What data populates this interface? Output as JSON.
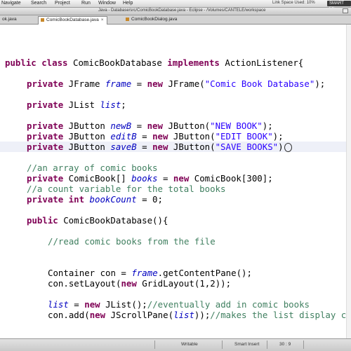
{
  "menubar": {
    "items": [
      "Navigate",
      "Search",
      "Project",
      "Run",
      "Window",
      "Help"
    ],
    "status": "Link Space Used: 10%",
    "badge": "SMART FIL"
  },
  "window": {
    "title": "Java - Database/src/ComicBookDatabase.java - Eclipse - /Volumes/CANTELE/workspace"
  },
  "tabs": [
    {
      "label": "ok.java",
      "active": false
    },
    {
      "label": "ComicBookDatabase.java",
      "active": true
    },
    {
      "label": "ComicBookDialog.java",
      "active": false
    }
  ],
  "code": {
    "class_decl": {
      "kw": "public class",
      "name": " ComicBookDatabase ",
      "kw2": "implements",
      "rest": " ActionListener{"
    },
    "frame_line": {
      "kw": "private",
      "type": " JFrame ",
      "field": "frame",
      "mid": " = ",
      "kw2": "new",
      "ctor": " JFrame(",
      "str": "\"Comic Book Database\"",
      "end": ");"
    },
    "list_line": {
      "kw": "private",
      "type": " JList ",
      "field": "list",
      "end": ";"
    },
    "newb_line": {
      "kw": "private",
      "type": " JButton ",
      "field": "newB",
      "mid": " = ",
      "kw2": "new",
      "ctor": " JButton(",
      "str": "\"NEW BOOK\"",
      "end": ");"
    },
    "editb_line": {
      "kw": "private",
      "type": " JButton ",
      "field": "editB",
      "mid": " = ",
      "kw2": "new",
      "ctor": " JButton(",
      "str": "\"EDIT BOOK\"",
      "end": ");"
    },
    "saveb_line": {
      "kw": "private",
      "type": " JButton ",
      "field": "saveB",
      "mid": " = ",
      "kw2": "new",
      "ctor": " JButton(",
      "str": "\"SAVE BOOKS\"",
      "end": ")"
    },
    "comment1": "//an array of comic books",
    "books_line": {
      "kw": "private",
      "type": " ComicBook[] ",
      "field": "books",
      "mid": " = ",
      "kw2": "new",
      "rest": " ComicBook[300];"
    },
    "comment2": "//a count variable for the total books",
    "count_line": {
      "kw": "private int",
      "field": " bookCount",
      "rest": " = 0;"
    },
    "ctor_line": {
      "kw": "public",
      "rest": " ComicBookDatabase(){"
    },
    "comment3": "//read comic books from the file",
    "container_line": {
      "pre": "Container con = ",
      "field": "frame",
      "rest": ".getContentPane();"
    },
    "layout_line": {
      "pre": "con.setLayout(",
      "kw": "new",
      "rest": " GridLayout(1,2));"
    },
    "jlist_line": {
      "field": "list",
      "mid": " = ",
      "kw": "new",
      "rest": " JList();",
      "cmt": "//eventually add in comic books"
    },
    "scroll_line": {
      "pre": "con.add(",
      "kw": "new",
      "mid": " JScrollPane(",
      "field": "list",
      "rest": "));",
      "cmt": "//makes the list display co"
    }
  },
  "statusbar": {
    "mode": "Writable",
    "insert": "Smart Insert",
    "position": "30 : 9"
  }
}
